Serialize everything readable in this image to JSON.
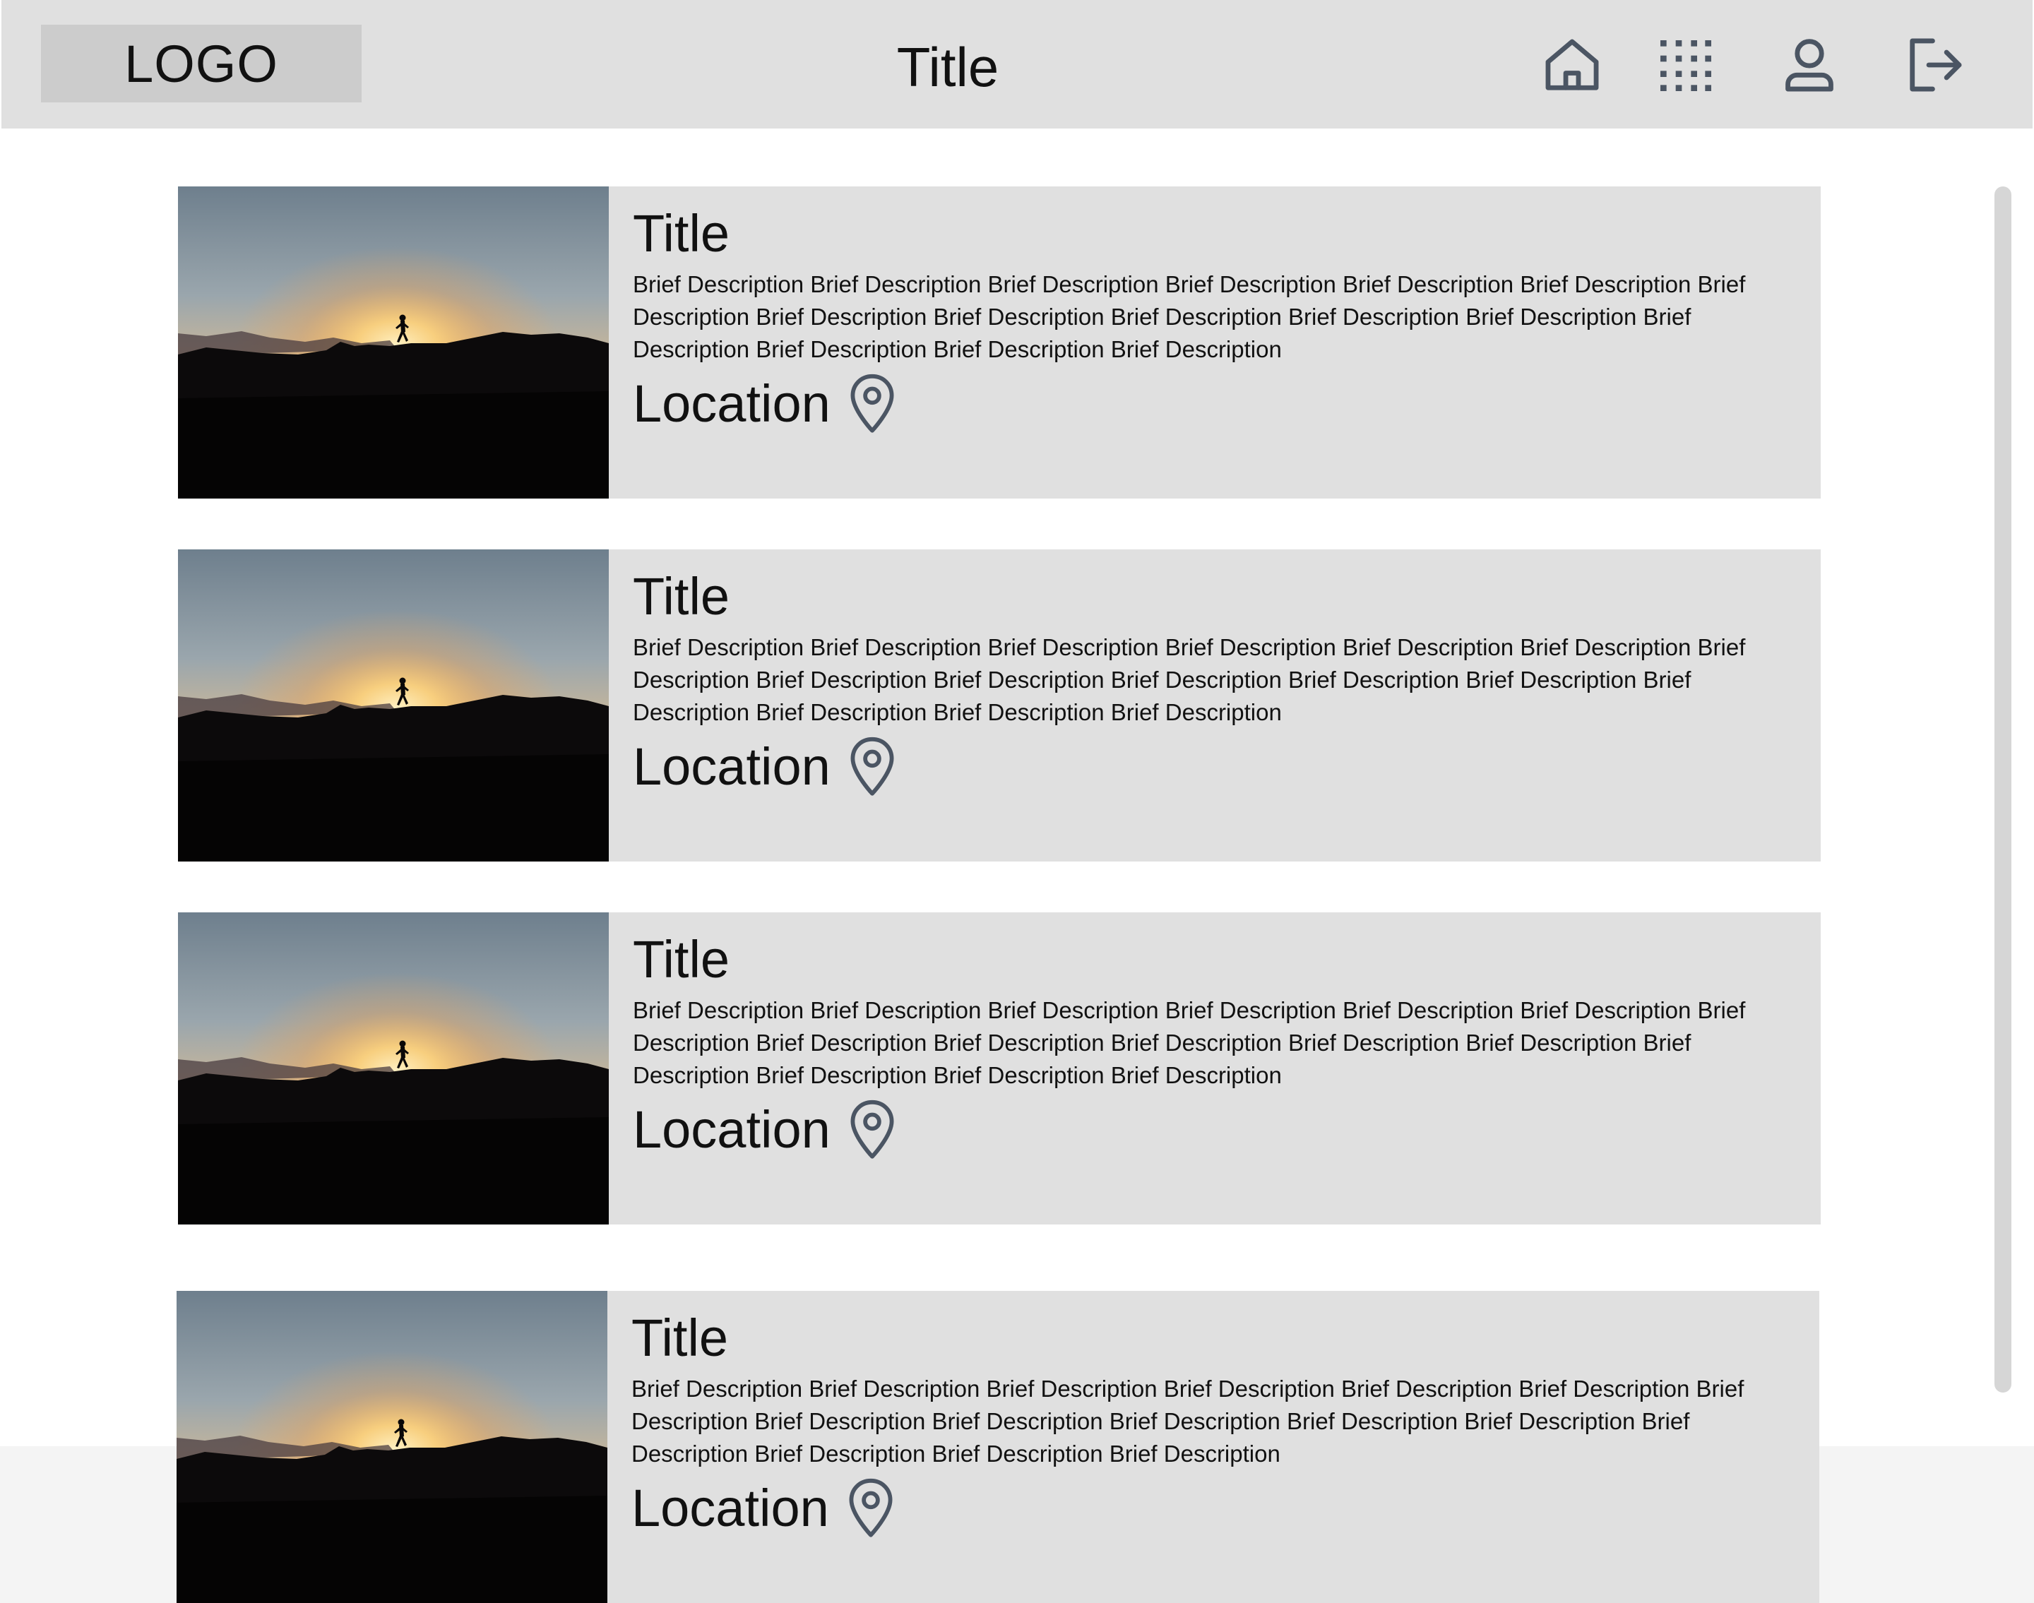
{
  "header": {
    "logo": "LOGO",
    "title": "Title",
    "icons": [
      "home-icon",
      "apps-grid-icon",
      "user-icon",
      "logout-icon"
    ]
  },
  "colors": {
    "header_bg": "#e0e0e0",
    "logo_bg": "#cccccc",
    "card_bg": "#e0e0e0",
    "icon_stroke": "#4b5563",
    "scrollbar": "#d6d6d6"
  },
  "cards": [
    {
      "title": "Title",
      "description": "Brief Description Brief Description Brief Description Brief Description Brief Description Brief Description Brief Description Brief Description Brief Description Brief Description Brief Description Brief Description Brief Description Brief Description Brief Description Brief Description",
      "location": "Location"
    },
    {
      "title": "Title",
      "description": "Brief Description Brief Description Brief Description Brief Description Brief Description Brief Description Brief Description Brief Description Brief Description Brief Description Brief Description Brief Description Brief Description Brief Description Brief Description Brief Description",
      "location": "Location"
    },
    {
      "title": "Title",
      "description": "Brief Description Brief Description Brief Description Brief Description Brief Description Brief Description Brief Description Brief Description Brief Description Brief Description Brief Description Brief Description Brief Description Brief Description Brief Description Brief Description",
      "location": "Location"
    },
    {
      "title": "Title",
      "description": "Brief Description Brief Description Brief Description Brief Description Brief Description Brief Description Brief Description Brief Description Brief Description Brief Description Brief Description Brief Description Brief Description Brief Description Brief Description Brief Description",
      "location": "Location"
    }
  ]
}
